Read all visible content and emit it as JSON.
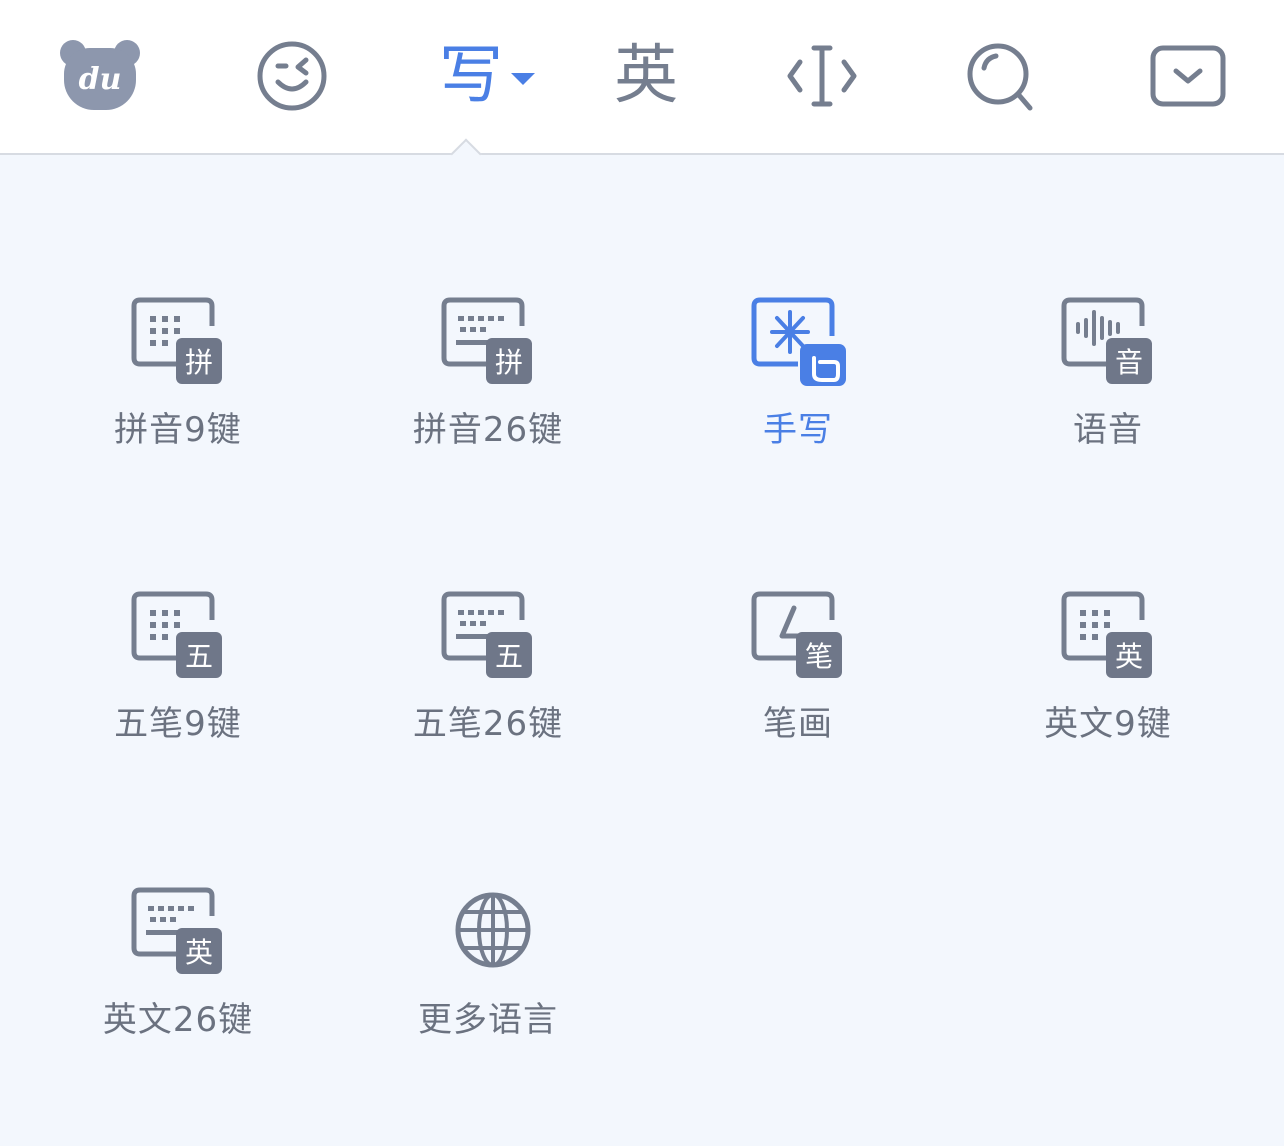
{
  "toolbar": {
    "logo_text": "du",
    "emoji_icon": "winking-face-icon",
    "active_mode_label": "写",
    "english_label": "英",
    "cursor_icon": "text-cursor-icon",
    "search_icon": "search-icon",
    "hide_keyboard_icon": "hide-keyboard-icon"
  },
  "colors": {
    "accent": "#4a7fe5",
    "icon": "#757e8f",
    "bg": "#f3f7fd"
  },
  "modes": [
    {
      "label": "拼音9键",
      "badge": "拼",
      "icon": "keypad-9-icon",
      "active": false
    },
    {
      "label": "拼音26键",
      "badge": "拼",
      "icon": "keyboard-26-icon",
      "active": false
    },
    {
      "label": "手写",
      "badge": "",
      "icon": "handwriting-icon",
      "active": true
    },
    {
      "label": "语音",
      "badge": "音",
      "icon": "voice-wave-icon",
      "active": false
    },
    {
      "label": "五笔9键",
      "badge": "五",
      "icon": "keypad-9-icon",
      "active": false
    },
    {
      "label": "五笔26键",
      "badge": "五",
      "icon": "keyboard-26-icon",
      "active": false
    },
    {
      "label": "笔画",
      "badge": "笔",
      "icon": "stroke-icon",
      "active": false
    },
    {
      "label": "英文9键",
      "badge": "英",
      "icon": "keypad-9-icon",
      "active": false
    },
    {
      "label": "英文26键",
      "badge": "英",
      "icon": "keyboard-26-icon",
      "active": false
    },
    {
      "label": "更多语言",
      "badge": "",
      "icon": "globe-icon",
      "active": false
    }
  ]
}
